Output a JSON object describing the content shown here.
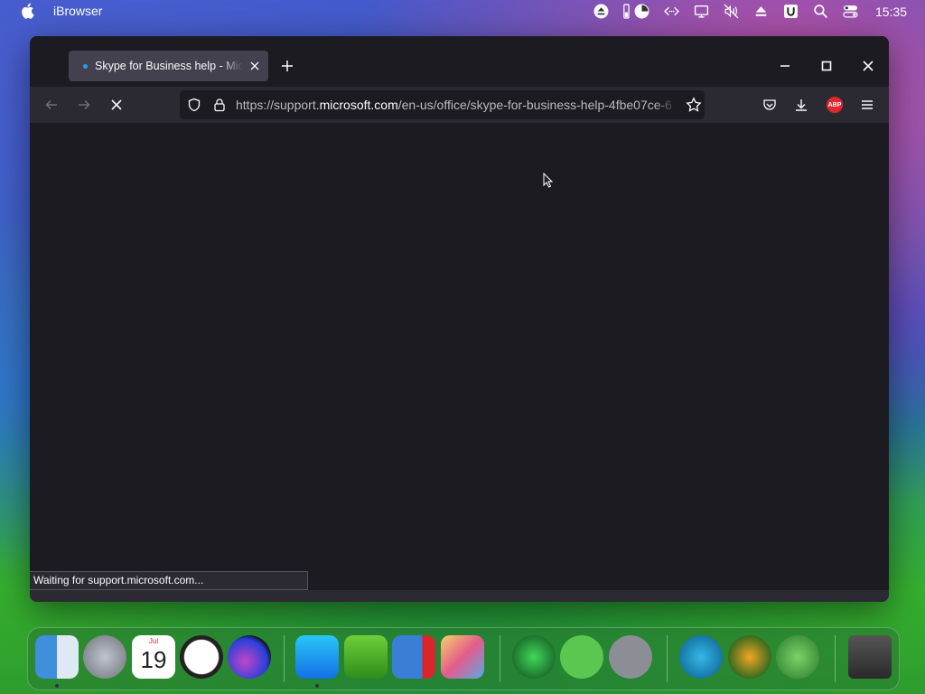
{
  "menubar": {
    "app_name": "iBrowser",
    "clock": "15:35",
    "status_icons": [
      "eject-icon",
      "battery-icon",
      "pie-chart-icon",
      "code-icon",
      "display-icon",
      "mute-icon",
      "eject-icon",
      "u-icon",
      "search-icon",
      "control-center-icon"
    ]
  },
  "browser": {
    "tab_title": "Skype for Business help - Microsoft Support",
    "url_prefix": "https://support.",
    "url_host": "microsoft.com",
    "url_path": "/en-us/office/skype-for-business-help-4fbe07ce-6",
    "abp_label": "ABP",
    "status_text": "Waiting for support.microsoft.com..."
  },
  "dock": {
    "calendar_month": "Jul",
    "calendar_day": "19",
    "apps": [
      "finder",
      "launchpad",
      "calendar",
      "clock",
      "siri",
      "safari",
      "utorrent",
      "parallels",
      "preview",
      "collabsysos",
      "link",
      "utilities",
      "www",
      "downloader",
      "network",
      "trash"
    ]
  },
  "colors": {
    "window_bg": "#1c1b22",
    "toolbar_bg": "#2b2a33",
    "tab_bg": "#42414d",
    "abp_red": "#e0262f"
  }
}
